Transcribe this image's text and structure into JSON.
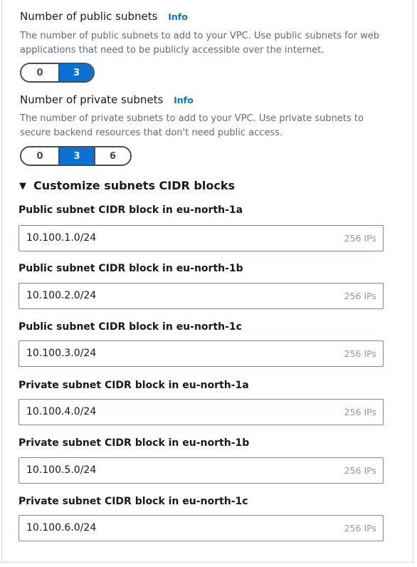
{
  "public_subnets": {
    "title": "Number of public subnets",
    "info": "Info",
    "description": "The number of public subnets to add to your VPC. Use public subnets for web applications that need to be publicly accessible over the internet.",
    "options": [
      "0",
      "3"
    ],
    "selected": "3"
  },
  "private_subnets": {
    "title": "Number of private subnets",
    "info": "Info",
    "description": "The number of private subnets to add to your VPC. Use private subnets to secure backend resources that don't need public access.",
    "options": [
      "0",
      "3",
      "6"
    ],
    "selected": "3"
  },
  "customize": {
    "label": "Customize subnets CIDR blocks",
    "expanded": true
  },
  "cidr_fields": [
    {
      "label": "Public subnet CIDR block in eu-north-1a",
      "value": "10.100.1.0/24",
      "hint": "256 IPs"
    },
    {
      "label": "Public subnet CIDR block in eu-north-1b",
      "value": "10.100.2.0/24",
      "hint": "256 IPs"
    },
    {
      "label": "Public subnet CIDR block in eu-north-1c",
      "value": "10.100.3.0/24",
      "hint": "256 IPs"
    },
    {
      "label": "Private subnet CIDR block in eu-north-1a",
      "value": "10.100.4.0/24",
      "hint": "256 IPs"
    },
    {
      "label": "Private subnet CIDR block in eu-north-1b",
      "value": "10.100.5.0/24",
      "hint": "256 IPs"
    },
    {
      "label": "Private subnet CIDR block in eu-north-1c",
      "value": "10.100.6.0/24",
      "hint": "256 IPs"
    }
  ],
  "colors": {
    "accent": "#0972d3",
    "segment_border": "#414d5c",
    "secondary_text": "#5f6b7a"
  }
}
